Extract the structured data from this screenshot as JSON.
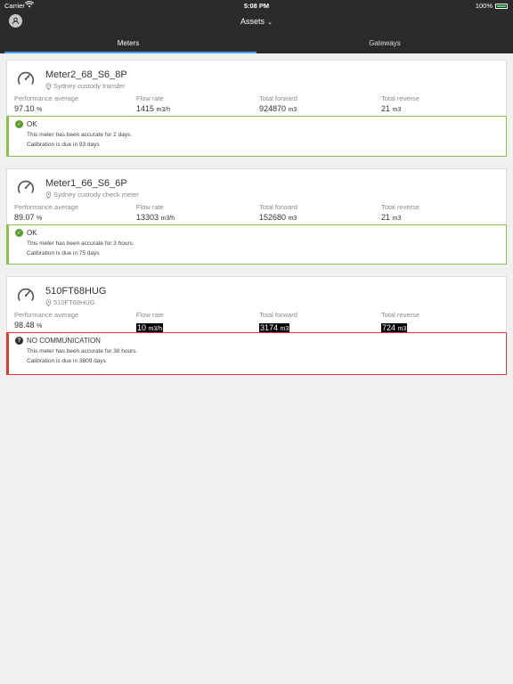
{
  "status_bar": {
    "carrier": "Carrier",
    "time": "5:08 PM",
    "battery": "100%"
  },
  "nav": {
    "title": "Assets"
  },
  "tabs": [
    {
      "label": "Meters",
      "active": true
    },
    {
      "label": "Gateways",
      "active": false
    }
  ],
  "metric_labels": {
    "performance": "Performance average",
    "flow": "Flow rate",
    "forward": "Total forward",
    "reverse": "Total reverse"
  },
  "meters": [
    {
      "name": "Meter2_68_S6_8P",
      "location": "Sydney custody transfer",
      "performance": "97.10",
      "performance_unit": "%",
      "flow": "1415",
      "flow_unit": "m3/h",
      "forward": "924870",
      "forward_unit": "m3",
      "reverse": "21",
      "reverse_unit": "m3",
      "status": "OK",
      "status_icon": "check-icon",
      "accuracy": "This meter has been accurate for 2 days.",
      "calibration": "Calibration is due in 93 days"
    },
    {
      "name": "Meter1_66_S6_6P",
      "location": "Sydney custody check meter",
      "performance": "89.07",
      "performance_unit": "%",
      "flow": "13303",
      "flow_unit": "m3/h",
      "forward": "152680",
      "forward_unit": "m3",
      "reverse": "21",
      "reverse_unit": "m3",
      "status": "OK",
      "status_icon": "check-icon",
      "accuracy": "This meter has been accurate for 3 hours.",
      "calibration": "Calibration is due in 75 days"
    },
    {
      "name": "510FT68HUG",
      "location": "510FT68HUG",
      "performance": "98.48",
      "performance_unit": "%",
      "flow": "10",
      "flow_unit": "m3/h",
      "forward": "3174",
      "forward_unit": "m3",
      "reverse": "724",
      "reverse_unit": "m3",
      "status": "NO COMMUNICATION",
      "status_icon": "question-icon",
      "accuracy": "This meter has been accurate for 38 hours.",
      "calibration": "Calibration is due in 3809 days"
    }
  ],
  "colors": {
    "ok": "#8bc34a",
    "error": "#e53935",
    "tab_indicator": "#42a5f5",
    "header": "#2b2b2b"
  }
}
